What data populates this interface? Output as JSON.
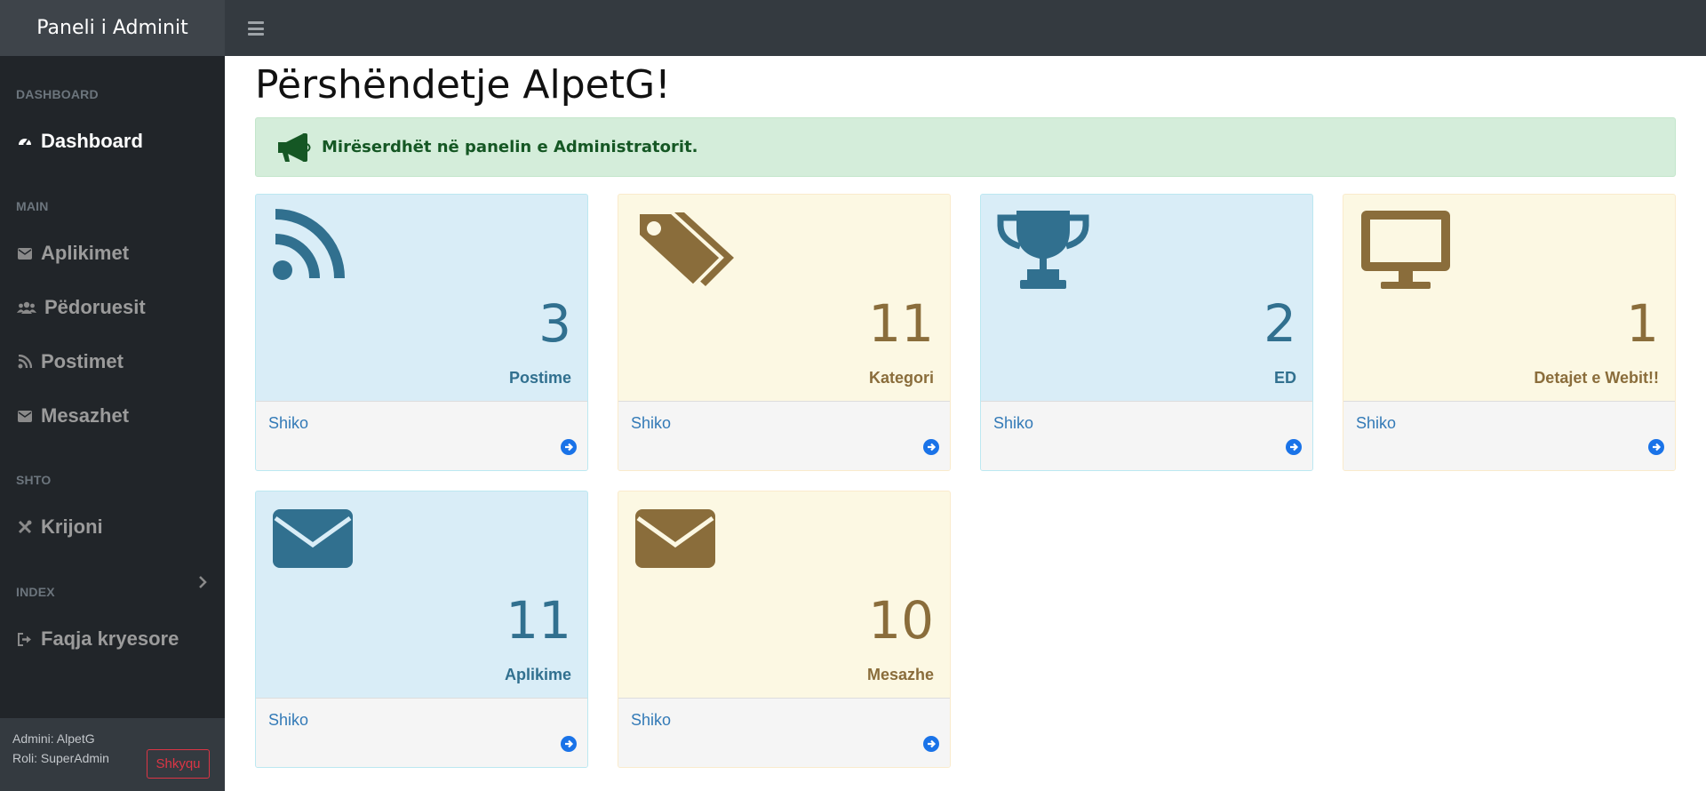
{
  "header": {
    "brand": "Paneli i Adminit",
    "menu_icon": "bars-icon"
  },
  "sidebar": {
    "sections": [
      {
        "heading": "DASHBOARD",
        "items": [
          {
            "label": "Dashboard",
            "icon": "tachometer-icon",
            "active": true
          }
        ]
      },
      {
        "heading": "MAIN",
        "items": [
          {
            "label": "Aplikimet",
            "icon": "envelope-icon"
          },
          {
            "label": "Pëdoruesit",
            "icon": "users-icon"
          },
          {
            "label": "Postimet",
            "icon": "rss-icon"
          },
          {
            "label": "Mesazhet",
            "icon": "envelope-icon"
          }
        ]
      },
      {
        "heading": "SHTO",
        "items": [
          {
            "label": "Krijoni",
            "icon": "wrench-icon"
          }
        ]
      },
      {
        "heading": "INDEX",
        "items": [
          {
            "label": "Faqja kryesore",
            "icon": "sign-out-icon"
          }
        ]
      }
    ],
    "footer": {
      "admin": "Admini: AlpetG",
      "role": "Roli: SuperAdmin",
      "logout": "Shkyqu"
    }
  },
  "main": {
    "title": "Përshëndetje AlpetG!",
    "alert": "Mirëserdhët në panelin e Administratorit.",
    "cards": [
      {
        "count": "3",
        "label": "Postime",
        "link": "Shiko",
        "icon": "rss-icon",
        "theme": "blue"
      },
      {
        "count": "11",
        "label": "Kategori",
        "link": "Shiko",
        "icon": "tags-icon",
        "theme": "yellow"
      },
      {
        "count": "2",
        "label": "ED",
        "link": "Shiko",
        "icon": "trophy-icon",
        "theme": "blue"
      },
      {
        "count": "1",
        "label": "Detajet e Webit!!",
        "link": "Shiko",
        "icon": "desktop-icon",
        "theme": "yellow"
      },
      {
        "count": "11",
        "label": "Aplikime",
        "link": "Shiko",
        "icon": "envelope-icon",
        "theme": "blue"
      },
      {
        "count": "10",
        "label": "Mesazhe",
        "link": "Shiko",
        "icon": "envelope-icon",
        "theme": "yellow"
      }
    ]
  },
  "colors": {
    "topbar": "#343a40",
    "sidebar": "#212529",
    "card_blue": "#d9edf7",
    "card_yellow": "#fcf8e3",
    "blue_text": "#31708f",
    "yellow_text": "#8a6d3b",
    "link": "#337ab7",
    "logout": "#dc3545",
    "alert_bg": "#d4edda",
    "alert_text": "#155724"
  }
}
